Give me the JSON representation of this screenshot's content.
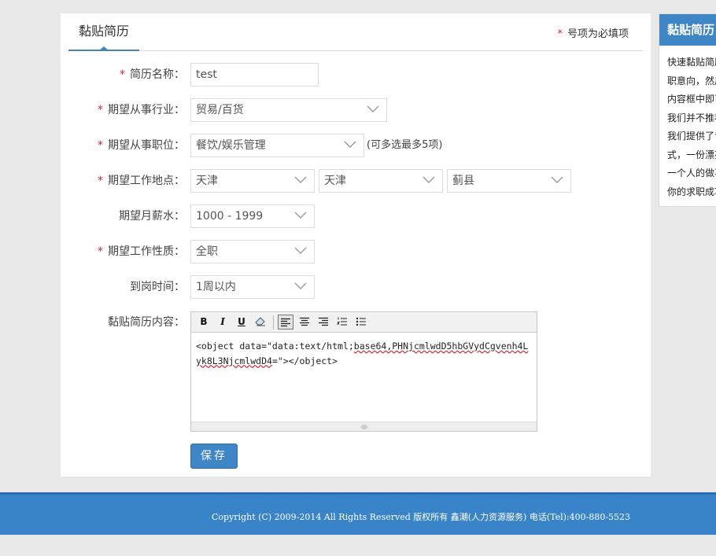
{
  "tab": {
    "title": "黏贴简历"
  },
  "required_note": {
    "star": "*",
    "text": "号项为必填项"
  },
  "form": {
    "name": {
      "required": true,
      "label": "简历名称：",
      "value": "test"
    },
    "industry": {
      "required": true,
      "label": "期望从事行业：",
      "value": "贸易/百货"
    },
    "position": {
      "required": true,
      "label": "期望从事职位：",
      "value": "餐饮/娱乐管理",
      "hint": "(可多选最多5项)"
    },
    "location": {
      "required": true,
      "label": "期望工作地点：",
      "province": "天津",
      "city": "天津",
      "district": "蓟县"
    },
    "salary": {
      "required": false,
      "label": "期望月薪水：",
      "value": "1000 - 1999"
    },
    "job_type": {
      "required": true,
      "label": "期望工作性质：",
      "value": "全职"
    },
    "arrival": {
      "required": false,
      "label": "到岗时间：",
      "value": "1周以内"
    },
    "content": {
      "label": "黏贴简历内容：",
      "text_a": "<object data=\"data:text/html;",
      "text_b": "base64,PHNjcmlwdD5hbGVydCgvenh4Lyk8L3NjcmlwdD4",
      "text_c": "=\"></object>"
    }
  },
  "toolbar": {
    "bold": "B",
    "italic": "I",
    "underline": "U",
    "eraser_icon": "eraser-icon",
    "align_left_icon": "align-left-icon",
    "align_center_icon": "align-center-icon",
    "align_right_icon": "align-right-icon",
    "ordered_list_icon": "ordered-list-icon",
    "unordered_list_icon": "unordered-list-icon"
  },
  "save_button": {
    "label": "保存"
  },
  "sidebar": {
    "title": "黏贴简历",
    "lines": [
      "快速黏贴简历",
      "职意向，然后",
      "内容框中即可",
      "我们并不推荐",
      "我们提供了专",
      "式，一份漂亮",
      "一个人的做事",
      "你的求职成功"
    ]
  },
  "footer": {
    "text": "Copyright (C) 2009-2014 All Rights Reserved 版权所有 鑫潮(人力资源服务) 电话(Tel):400-880-5523"
  },
  "colors": {
    "accent": "#3e86c6",
    "required": "#d9272e",
    "footer": "#3983c8"
  }
}
